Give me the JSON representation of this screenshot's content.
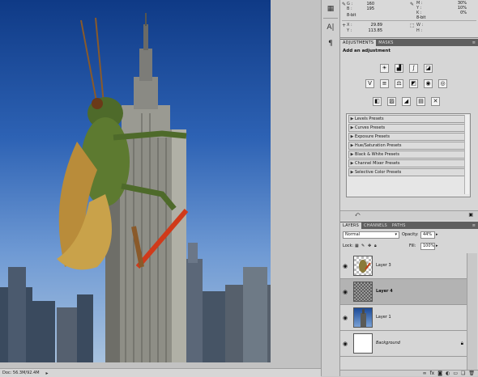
{
  "status_bar": {
    "doc_info": "Doc: 56.3M/92.4M",
    "arrow": "▸"
  },
  "info_panel": {
    "rgb": [
      {
        "label": "G :",
        "value": "160"
      },
      {
        "label": "B :",
        "value": "195"
      }
    ],
    "cmyk": [
      {
        "label": "M :",
        "value": "30%"
      },
      {
        "label": "Y :",
        "value": "10%"
      },
      {
        "label": "K :",
        "value": "0%"
      }
    ],
    "bit_left": "8-bit",
    "bit_right": "8-bit",
    "xy": [
      {
        "label": "X :",
        "value": "29.89"
      },
      {
        "label": "Y :",
        "value": "113.85"
      }
    ],
    "wh": [
      {
        "label": "W :",
        "value": ""
      },
      {
        "label": "H :",
        "value": ""
      }
    ]
  },
  "adjustments": {
    "tabs": [
      "ADJUSTMENTS",
      "MASKS"
    ],
    "menu_icon": "≡",
    "title": "Add an adjustment",
    "icons": [
      "brightness-contrast-icon",
      "levels-icon",
      "curves-icon",
      "exposure-icon",
      "vibrance-icon",
      "hue-saturation-icon",
      "color-balance-icon",
      "black-white-icon",
      "photo-filter-icon",
      "channel-mixer-icon",
      "invert-icon",
      "posterize-icon",
      "threshold-icon",
      "gradient-map-icon",
      "selective-color-icon"
    ],
    "presets": [
      "Levels Presets",
      "Curves Presets",
      "Exposure Presets",
      "Hue/Saturation Presets",
      "Black & White Presets",
      "Channel Mixer Presets",
      "Selective Color Presets"
    ]
  },
  "layers": {
    "tabs": [
      "LAYERS",
      "CHANNELS",
      "PATHS"
    ],
    "menu_icon": "≡",
    "blend_mode": "Normal",
    "opacity_label": "Opacity:",
    "opacity_value": "44%",
    "lock_label": "Lock:",
    "fill_label": "Fill:",
    "fill_value": "100%",
    "items": [
      {
        "name": "Layer 3",
        "selected": false,
        "thumb": "grasshopper"
      },
      {
        "name": "Layer 4",
        "selected": true,
        "thumb": "checker"
      },
      {
        "name": "Layer 1",
        "selected": false,
        "thumb": "building"
      },
      {
        "name": "Background",
        "selected": false,
        "thumb": "white"
      }
    ],
    "footer_icons": [
      "link-icon",
      "fx-icon",
      "mask-icon",
      "adjustment-layer-icon",
      "group-icon",
      "new-layer-icon",
      "trash-icon"
    ]
  },
  "colors": {
    "sky_top": "#0f3a86",
    "sky_bottom": "#a8c2de",
    "panel_tab_bar": "#5f5f5f",
    "selected_layer": "#b3b3b3"
  }
}
